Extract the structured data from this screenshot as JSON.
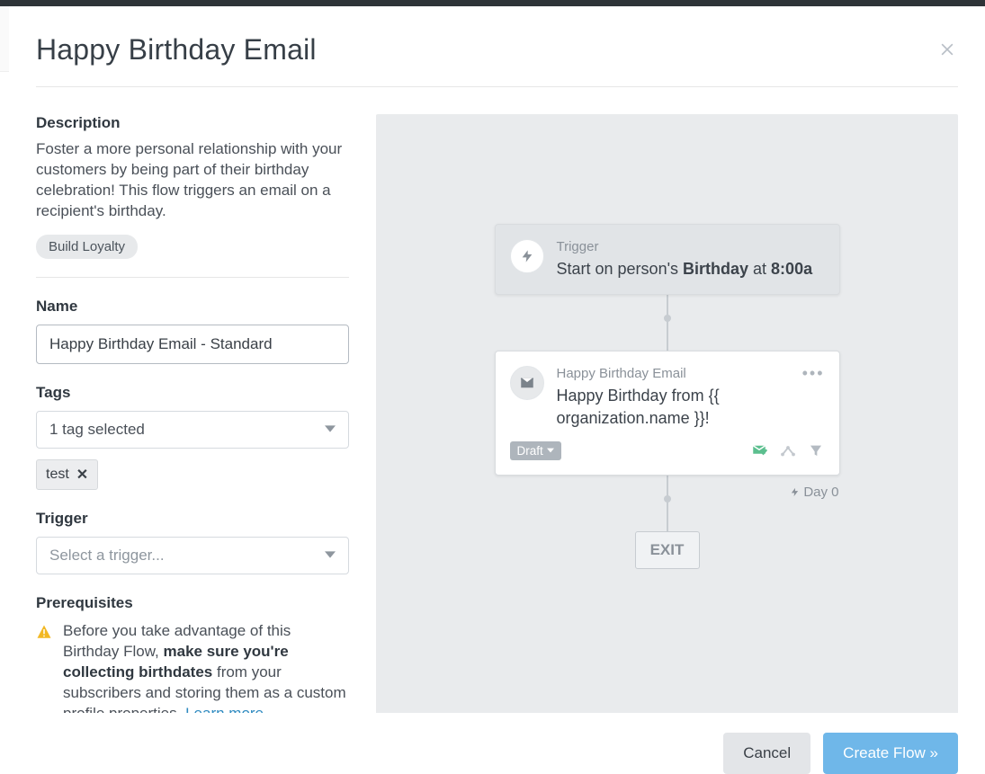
{
  "modal": {
    "title": "Happy Birthday Email"
  },
  "description": {
    "label": "Description",
    "text": "Foster a more personal relationship with your customers by being part of their birthday celebration! This flow triggers an email on a recipient's birthday.",
    "category_pill": "Build Loyalty"
  },
  "name_field": {
    "label": "Name",
    "value": "Happy Birthday Email - Standard"
  },
  "tags_field": {
    "label": "Tags",
    "summary": "1 tag selected",
    "chips": [
      {
        "label": "test"
      }
    ]
  },
  "trigger_field": {
    "label": "Trigger",
    "placeholder": "Select a trigger..."
  },
  "prereq": {
    "label": "Prerequisites",
    "pre_text": "Before you take advantage of this Birthday Flow, ",
    "strong_text": "make sure you're collecting birthdates",
    "post_text": " from your subscribers and storing them as a custom profile properties. ",
    "link_text": "Learn more."
  },
  "preview": {
    "trigger_node": {
      "kicker": "Trigger",
      "line_pre": "Start on person's ",
      "line_strong": "Birthday",
      "line_mid": " at ",
      "line_strong2": "8:00a"
    },
    "email_node": {
      "kicker": "Happy Birthday Email",
      "body": "Happy Birthday from {{ organization.name }}!",
      "status": "Draft",
      "day": "Day 0"
    },
    "exit": "EXIT"
  },
  "footer": {
    "cancel": "Cancel",
    "create": "Create Flow »"
  }
}
